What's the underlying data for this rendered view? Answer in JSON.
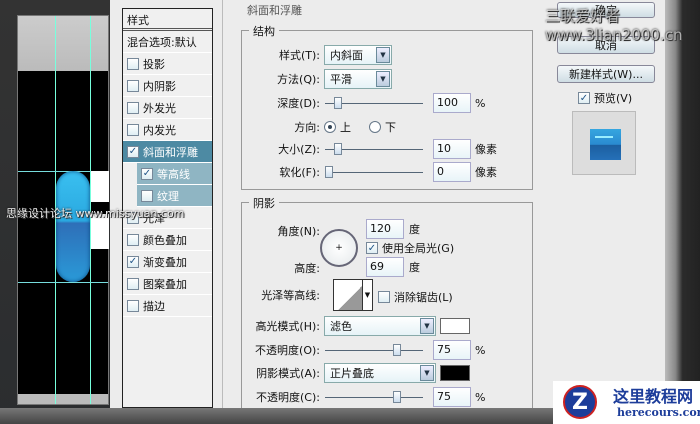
{
  "styles_panel": {
    "header": "样式",
    "blending": "混合选项:默认",
    "items": [
      {
        "label": "投影",
        "checked": false
      },
      {
        "label": "内阴影",
        "checked": false
      },
      {
        "label": "外发光",
        "checked": false
      },
      {
        "label": "内发光",
        "checked": false
      },
      {
        "label": "斜面和浮雕",
        "checked": true,
        "selected": true
      },
      {
        "label": "等高线",
        "checked": true,
        "sub": true
      },
      {
        "label": "纹理",
        "checked": false,
        "sub": true
      },
      {
        "label": "光泽",
        "checked": false
      },
      {
        "label": "颜色叠加",
        "checked": false
      },
      {
        "label": "渐变叠加",
        "checked": true
      },
      {
        "label": "图案叠加",
        "checked": false
      },
      {
        "label": "描边",
        "checked": false
      }
    ]
  },
  "panel_title": "斜面和浮雕",
  "structure": {
    "title": "结构",
    "style_label": "样式(T):",
    "style_value": "内斜面",
    "technique_label": "方法(Q):",
    "technique_value": "平滑",
    "depth_label": "深度(D):",
    "depth_value": "100",
    "depth_unit": "%",
    "depth_slider": 0.1,
    "direction_label": "方向:",
    "dir_up": "上",
    "dir_down": "下",
    "size_label": "大小(Z):",
    "size_value": "10",
    "size_unit": "像素",
    "size_slider": 0.1,
    "soften_label": "软化(F):",
    "soften_value": "0",
    "soften_unit": "像素",
    "soften_slider": 0
  },
  "shading": {
    "title": "阴影",
    "angle_label": "角度(N):",
    "angle_value": "120",
    "angle_unit": "度",
    "global_light": "使用全局光(G)",
    "altitude_label": "高度:",
    "altitude_value": "69",
    "altitude_unit": "度",
    "gloss_label": "光泽等高线:",
    "antialias": "消除锯齿(L)",
    "highlight_label": "高光模式(H):",
    "highlight_value": "滤色",
    "highlight_color": "#ffffff",
    "opacity1_label": "不透明度(O):",
    "opacity1_value": "75",
    "opacity1_unit": "%",
    "opacity1_slider": 0.75,
    "shadow_label": "阴影模式(A):",
    "shadow_value": "正片叠底",
    "shadow_color": "#000000",
    "opacity2_label": "不透明度(C):",
    "opacity2_value": "75",
    "opacity2_unit": "%",
    "opacity2_slider": 0.75
  },
  "buttons": {
    "ok": "确定",
    "cancel": "取消",
    "new_style": "新建样式(W)...",
    "preview": "预览(V)"
  },
  "watermarks": {
    "top_right": "三联爱好者 www.3lian2000.cn",
    "left": "思缘设计论坛 www.missyuan.com",
    "bottom_cn": "这里教程网",
    "bottom_en": "herecours.com"
  }
}
